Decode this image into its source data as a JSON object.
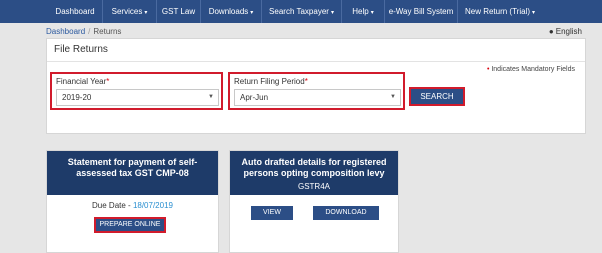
{
  "nav": {
    "items": [
      "Dashboard",
      "Services",
      "GST Law",
      "Downloads",
      "Search Taxpayer",
      "Help",
      "e-Way Bill System",
      "New Return (Trial)"
    ]
  },
  "breadcrumb": {
    "link": "Dashboard",
    "current": "Returns"
  },
  "language": "English",
  "panel": {
    "title": "File Returns",
    "mandatory_note": "Indicates Mandatory Fields",
    "financial_year_label": "Financial Year",
    "financial_year_value": "2019-20",
    "period_label": "Return Filing Period",
    "period_value": "Apr-Jun",
    "search_label": "SEARCH"
  },
  "card_cmp08": {
    "title": "Statement for payment of self-assessed tax GST CMP-08",
    "due_label": "Due Date -",
    "due_date": "18/07/2019",
    "prepare_label": "PREPARE ONLINE"
  },
  "card_gstr4a": {
    "title": "Auto drafted details for registered persons opting composition levy",
    "form_code": "GSTR4A",
    "view_label": "VIEW",
    "download_label": "DOWNLOAD"
  },
  "colors": {
    "nav_bg": "#2c4e86",
    "card_header_bg": "#1e3b69",
    "highlight_red": "#d11b2c",
    "due_date_blue": "#2a8fd0"
  }
}
